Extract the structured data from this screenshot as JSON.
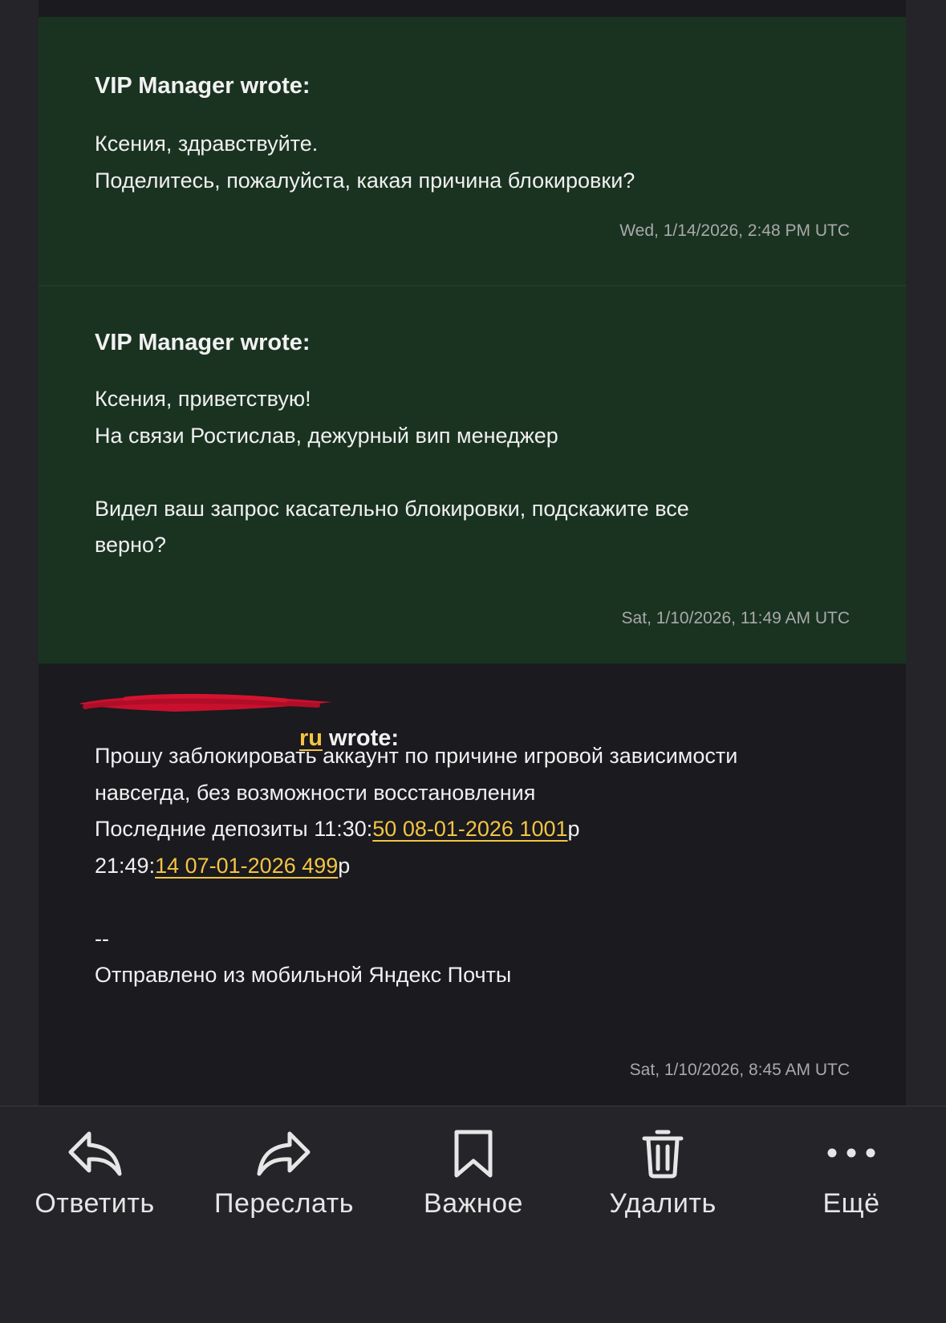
{
  "messages": [
    {
      "author": "VIP Manager wrote:",
      "lines": [
        "Ксения, здравствуйте.",
        "Поделитесь, пожалуйста, какая причина блокировки?"
      ],
      "timestamp": "Wed, 1/14/2026, 2:48 PM UTC"
    },
    {
      "author": "VIP Manager wrote:",
      "lines": [
        "Ксения, приветствую!",
        "На связи Ростислав, дежурный вип менеджер",
        "",
        "Видел ваш запрос касательно блокировки, подскажите все",
        "верно?"
      ],
      "timestamp": "Sat, 1/10/2026, 11:49 AM UTC"
    },
    {
      "author_email_visible": "ru",
      "author_suffix": " wrote:",
      "line1": "Прошу заблокировать аккаунт по причине игровой зависимости",
      "line2": "навсегда, без возможности восстановления",
      "line3_prefix": "Последние депозиты 11:30:",
      "line3_link": "50 08-01-2026 1001",
      "line3_suffix": "р",
      "line4_prefix": "21:49:",
      "line4_link": "14 07-01-2026 499",
      "line4_suffix": "р",
      "signature_dash": "--",
      "signature": "Отправлено из мобильной Яндекс Почты",
      "timestamp": "Sat, 1/10/2026, 8:45 AM UTC"
    }
  ],
  "toolbar": {
    "reply": {
      "label": "Ответить",
      "icon": "reply-icon"
    },
    "forward": {
      "label": "Переслать",
      "icon": "forward-icon"
    },
    "important": {
      "label": "Важное",
      "icon": "bookmark-icon"
    },
    "delete": {
      "label": "Удалить",
      "icon": "trash-icon"
    },
    "more": {
      "label": "Ещё",
      "icon": "more-dots-icon"
    }
  },
  "colors": {
    "manager_bg": "#1a3321",
    "user_bg": "#1a1a1f",
    "link": "#f4c542",
    "redaction": "#c8102e",
    "toolbar_bg": "#242429"
  }
}
